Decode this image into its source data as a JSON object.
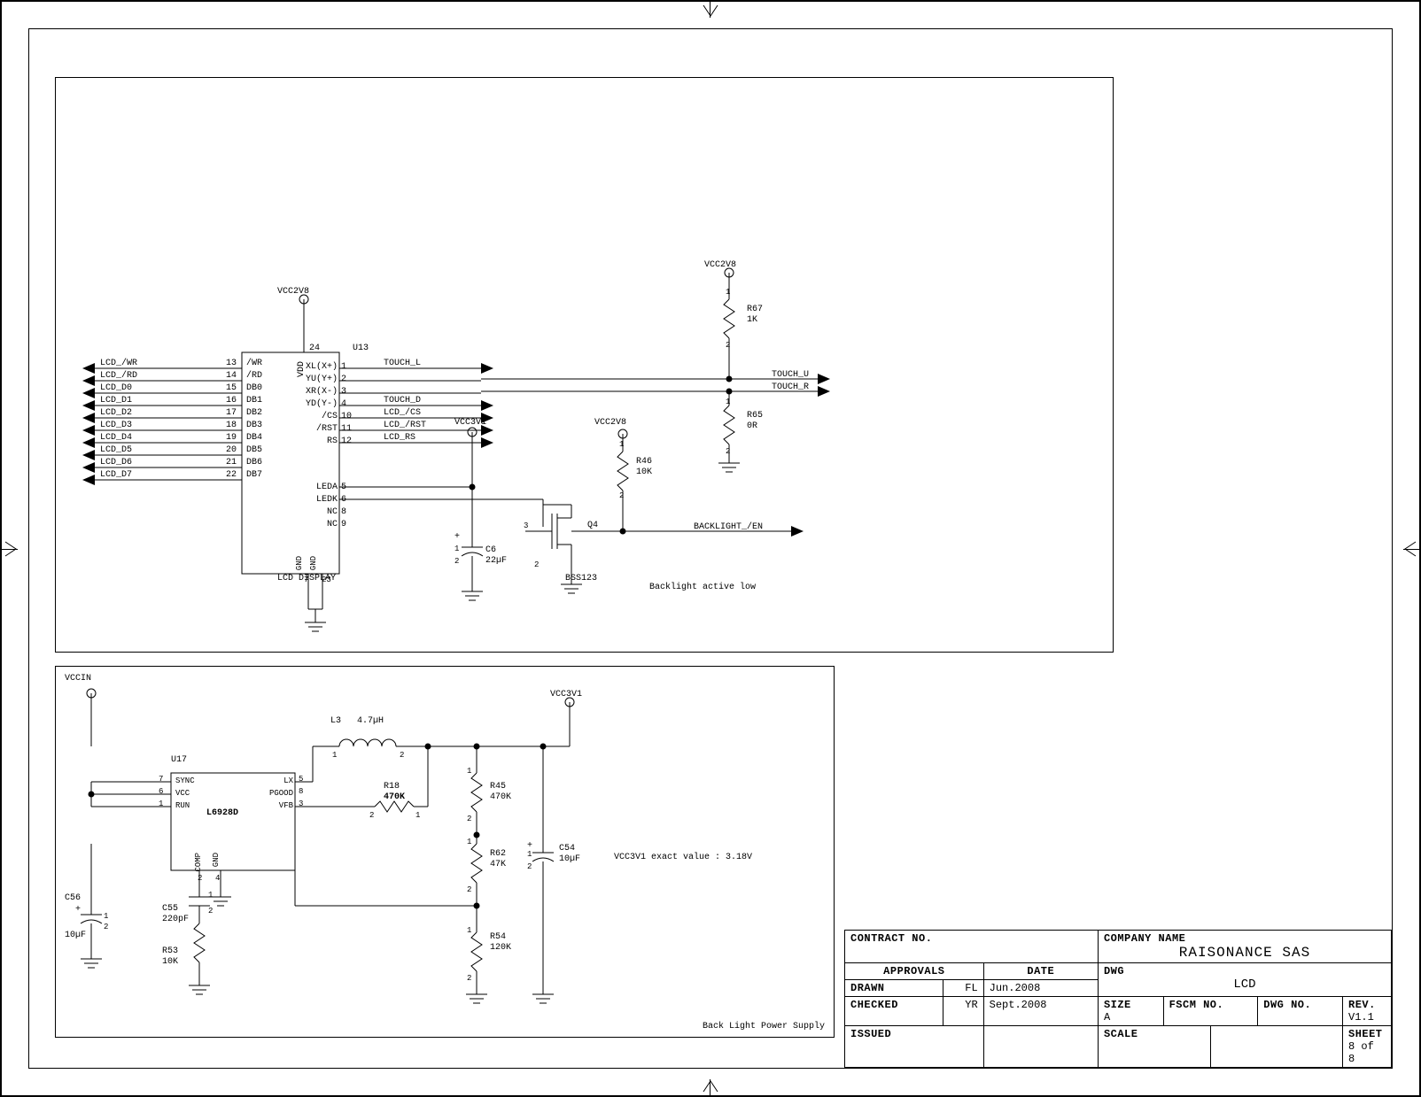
{
  "sheet": {
    "contract_no_label": "CONTRACT NO.",
    "company_name_label": "COMPANY NAME",
    "company_name": "RAISONANCE SAS",
    "approvals_label": "APPROVALS",
    "date_label": "DATE",
    "dwg_label": "DWG",
    "dwg_title": "LCD",
    "drawn_label": "DRAWN",
    "drawn_by": "FL",
    "drawn_date": "Jun.2008",
    "checked_label": "CHECKED",
    "checked_by": "YR",
    "checked_date": "Sept.2008",
    "issued_label": "ISSUED",
    "size_label": "SIZE",
    "size": "A",
    "fscm_label": "FSCM NO.",
    "dwgno_label": "DWG NO.",
    "rev_label": "REV.",
    "rev": "V1.1",
    "scale_label": "SCALE",
    "sheet_label": "SHEET",
    "sheet_num": "8 of 8"
  },
  "block1": {
    "title": "LCD DISPLAY",
    "ic_ref": "U13",
    "vcc2v8": "VCC2V8",
    "vcc3v1": "VCC3V1",
    "left_bus": [
      "LCD_/WR",
      "LCD_/RD",
      "LCD_D0",
      "LCD_D1",
      "LCD_D2",
      "LCD_D3",
      "LCD_D4",
      "LCD_D5",
      "LCD_D6",
      "LCD_D7"
    ],
    "left_pins": [
      "13",
      "14",
      "15",
      "16",
      "17",
      "18",
      "19",
      "20",
      "21",
      "22"
    ],
    "left_names": [
      "/WR",
      "/RD",
      "DB0",
      "DB1",
      "DB2",
      "DB3",
      "DB4",
      "DB5",
      "DB6",
      "DB7"
    ],
    "vdd_pin": "24",
    "vdd_name": "VDD",
    "bottom_pins": [
      "7",
      "23"
    ],
    "bottom_names": [
      "GND",
      "GND"
    ],
    "right_names": [
      "XL(X+)",
      "YU(Y+)",
      "XR(X-)",
      "YD(Y-)",
      "/CS",
      "/RST",
      "RS"
    ],
    "right_pins": [
      "1",
      "2",
      "3",
      "4",
      "10",
      "11",
      "12"
    ],
    "right_names2": [
      "LEDA",
      "LEDK",
      "NC",
      "NC"
    ],
    "right_pins2": [
      "5",
      "6",
      "8",
      "9"
    ],
    "nets_right": [
      "TOUCH_L",
      "",
      "",
      "TOUCH_D",
      "LCD_/CS",
      "LCD_/RST",
      "LCD_RS"
    ],
    "touch_u": "TOUCH_U",
    "touch_r": "TOUCH_R",
    "r67": {
      "ref": "R67",
      "val": "1K"
    },
    "r65": {
      "ref": "R65",
      "val": "0R"
    },
    "r46": {
      "ref": "R46",
      "val": "10K"
    },
    "c6": {
      "ref": "C6",
      "val": "22µF"
    },
    "q4": {
      "ref": "Q4",
      "part": "BSS123"
    },
    "backlight_en": "BACKLIGHT_/EN",
    "backlight_note": "Backlight active low"
  },
  "block2": {
    "title": "Back Light Power Supply",
    "vccin": "VCCIN",
    "vcc3v1": "VCC3V1",
    "note": "VCC3V1 exact value : 3.18V",
    "ic_ref": "U17",
    "ic_part": "L6928D",
    "left_pin_names": [
      "SYNC",
      "VCC",
      "RUN"
    ],
    "left_pin_nums": [
      "7",
      "6",
      "1"
    ],
    "right_pin_names": [
      "LX",
      "PGOOD",
      "VFB"
    ],
    "right_pin_nums": [
      "5",
      "8",
      "3"
    ],
    "bottom_pin_names": [
      "COMP",
      "GND"
    ],
    "bottom_pin_nums": [
      "2",
      "4"
    ],
    "l3": {
      "ref": "L3",
      "val": "4.7µH"
    },
    "c56": {
      "ref": "C56",
      "val": "10µF"
    },
    "c55": {
      "ref": "C55",
      "val": "220pF"
    },
    "c54": {
      "ref": "C54",
      "val": "10µF"
    },
    "r53": {
      "ref": "R53",
      "val": "10K"
    },
    "r18": {
      "ref": "R18",
      "val": "470K"
    },
    "r45": {
      "ref": "R45",
      "val": "470K"
    },
    "r62": {
      "ref": "R62",
      "val": "47K"
    },
    "r54": {
      "ref": "R54",
      "val": "120K"
    }
  }
}
